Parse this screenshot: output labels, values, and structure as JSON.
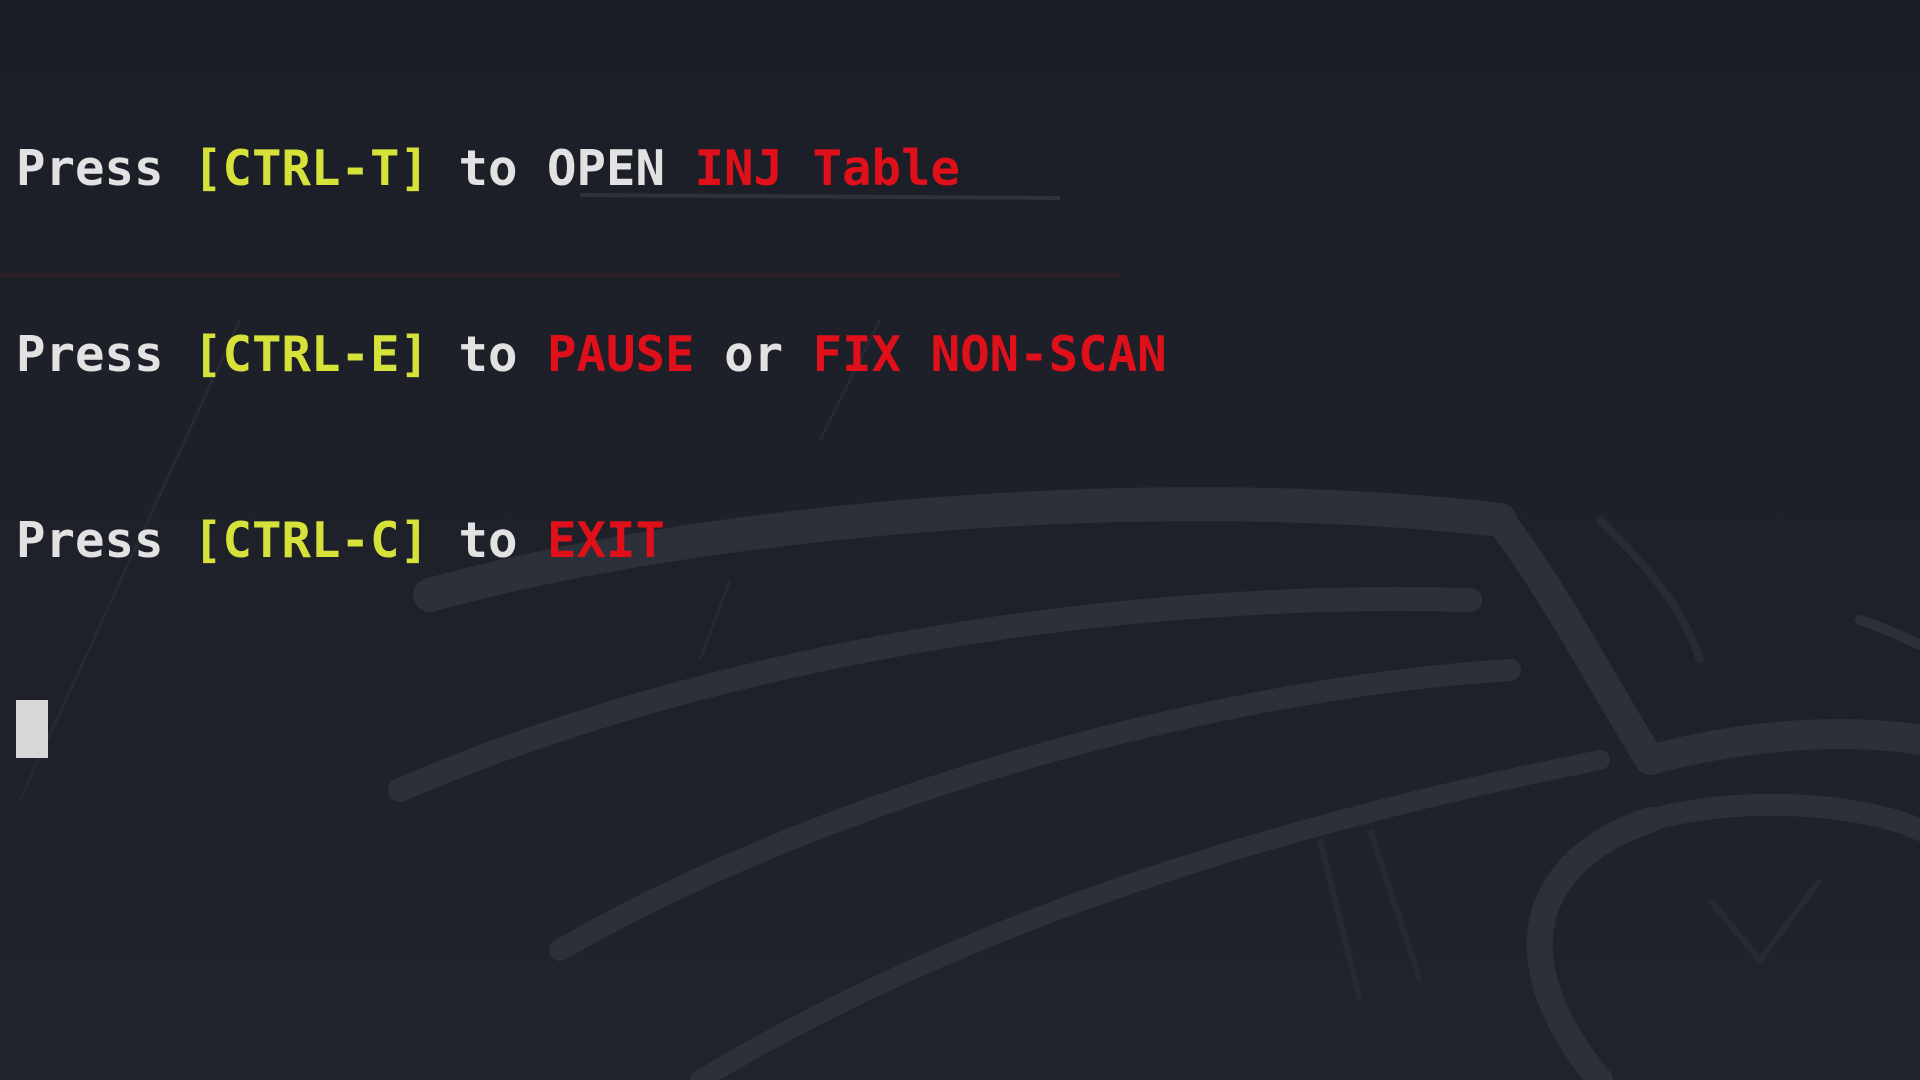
{
  "terminal": {
    "lines": [
      {
        "prefix": "Press ",
        "key": "[CTRL-T]",
        "middle": " to OPEN ",
        "action": "INJ Table"
      },
      {
        "prefix": "Press ",
        "key": "[CTRL-E]",
        "middle": " to ",
        "action": "PAUSE",
        "connector": " or ",
        "action2": "FIX NON-SCAN"
      },
      {
        "prefix": "Press ",
        "key": "[CTRL-C]",
        "middle": " to ",
        "action": "EXIT"
      }
    ]
  },
  "colors": {
    "background": "#1e2029",
    "text": "#e2e2e2",
    "key_highlight": "#d6e23a",
    "action_highlight": "#e0101a",
    "cursor": "#d8d8d8"
  },
  "icons": {
    "wallpaper": "kali-dragon-logo-icon"
  }
}
